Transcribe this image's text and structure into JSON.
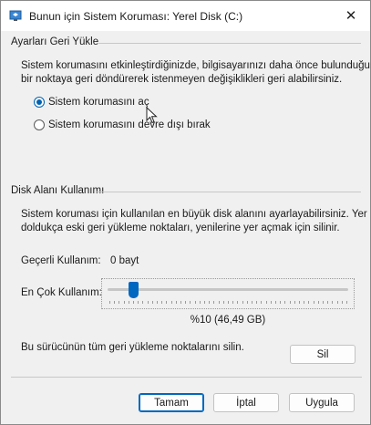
{
  "window": {
    "title": "Bunun için Sistem Koruması: Yerel Disk (C:)",
    "close_glyph": "✕"
  },
  "restore": {
    "group_label": "Ayarları Geri Yükle",
    "description_line1": "Sistem korumasını etkinleştirdiğinizde, bilgisayarınızı daha önce bulunduğu",
    "description_line2": "bir noktaya geri döndürerek istenmeyen değişiklikleri geri alabilirsiniz.",
    "option_on": "Sistem korumasını aç",
    "option_off": "Sistem korumasını devre dışı bırak",
    "selected": "on"
  },
  "disk": {
    "group_label": "Disk Alanı Kullanımı",
    "description_line1": "Sistem koruması için kullanılan en büyük disk alanını ayarlayabilirsiniz. Yer",
    "description_line2": "doldukça eski geri yükleme noktaları, yenilerine yer açmak için silinir.",
    "current_label": "Geçerli Kullanım:",
    "current_value": "0 bayt",
    "max_label": "En Çok Kullanım:",
    "slider_percent": 10,
    "slider_readout": "%10 (46,49 GB)",
    "delete_text": "Bu sürücünün tüm geri yükleme noktalarını silin.",
    "delete_button": "Sil"
  },
  "buttons": {
    "ok": "Tamam",
    "cancel": "İptal",
    "apply": "Uygula"
  },
  "colors": {
    "accent": "#0067c0"
  }
}
